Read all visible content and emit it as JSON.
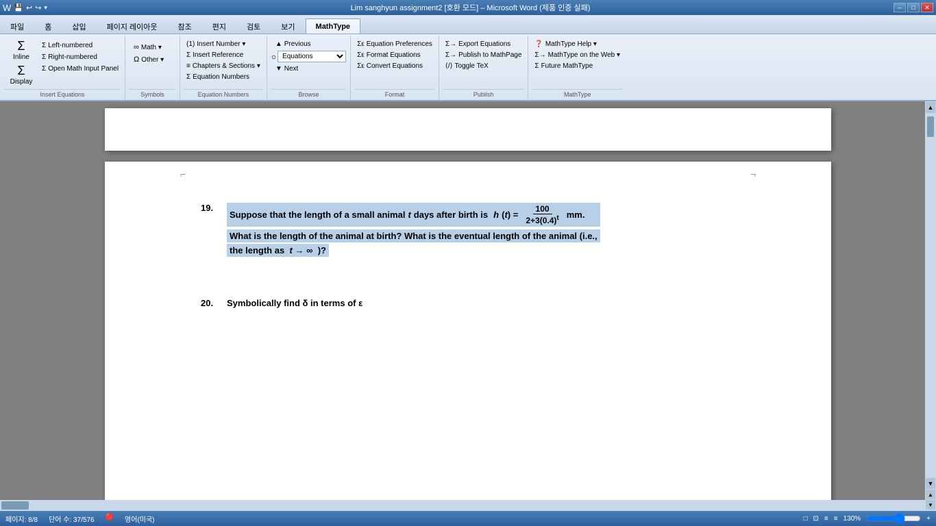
{
  "titlebar": {
    "title": "Lim sanghyun assignment2 [호환 모드] – Microsoft Word (제품 인증 실패)",
    "controls": [
      "–",
      "□",
      "✕"
    ]
  },
  "quickaccess": {
    "buttons": [
      "💾",
      "↩",
      "↪",
      "▾"
    ]
  },
  "tabs": [
    {
      "label": "파일",
      "active": false
    },
    {
      "label": "홈",
      "active": false
    },
    {
      "label": "삽입",
      "active": false
    },
    {
      "label": "페이지 레이아웃",
      "active": false
    },
    {
      "label": "참조",
      "active": false
    },
    {
      "label": "편지",
      "active": false
    },
    {
      "label": "검토",
      "active": false
    },
    {
      "label": "보기",
      "active": false
    },
    {
      "label": "MathType",
      "active": true
    }
  ],
  "ribbon": {
    "groups": [
      {
        "name": "Insert Equations",
        "items": [
          {
            "type": "large",
            "icon": "Σ",
            "label": "Inline"
          },
          {
            "type": "large",
            "icon": "Σ",
            "label": "Display"
          },
          {
            "type": "small",
            "icon": "Σ",
            "label": "Left-numbered"
          },
          {
            "type": "small",
            "icon": "Σ",
            "label": "Right-numbered"
          },
          {
            "type": "small",
            "icon": "Σ",
            "label": "Open Math Input Panel"
          }
        ]
      },
      {
        "name": "Symbols",
        "items": [
          {
            "icon": "∞",
            "label": "Math ▾"
          },
          {
            "icon": "Ω",
            "label": "Other ▾"
          }
        ]
      },
      {
        "name": "Equation Numbers",
        "items": [
          {
            "icon": "(1)",
            "label": "Insert Number ▾"
          },
          {
            "icon": "Σ",
            "label": "Insert Reference"
          },
          {
            "icon": "≡",
            "label": "Chapters & Sections ▾"
          },
          {
            "icon": "Σ",
            "label": "Equation Numbers"
          }
        ]
      },
      {
        "name": "Browse",
        "items": [
          {
            "label": "Previous"
          },
          {
            "label": "Equations"
          },
          {
            "label": "Next"
          }
        ],
        "dropdown": "Equations"
      },
      {
        "name": "Format",
        "items": [
          {
            "icon": "Σ",
            "label": "Equation Preferences"
          },
          {
            "icon": "Σ",
            "label": "Format Equations"
          },
          {
            "icon": "Σ",
            "label": "Convert Equations"
          }
        ]
      },
      {
        "name": "Publish",
        "items": [
          {
            "icon": "Σ",
            "label": "Export Equations"
          },
          {
            "icon": "Σ",
            "label": "Publish to MathPage"
          },
          {
            "icon": "Σ",
            "label": "Toggle TeX"
          }
        ]
      },
      {
        "name": "MathType",
        "items": [
          {
            "icon": "?",
            "label": "MathType Help ▾"
          },
          {
            "icon": "Σ",
            "label": "MathType on the Web ▾"
          },
          {
            "icon": "Σ",
            "label": "Future MathType"
          }
        ]
      }
    ]
  },
  "document": {
    "problem19": {
      "number": "19.",
      "text1": "Suppose that the length of a small animal",
      "var_t": "t",
      "text2": "days after birth is",
      "func": "h(t) =",
      "fraction_num": "100",
      "fraction_den": "2+3(0.4)",
      "exp": "t",
      "unit": "mm.",
      "text3": "What is the length of the animal at birth? What is the eventual length of the animal (i.e.,",
      "text4": "the length as",
      "arrow": "t → ∞",
      "text5": ")?"
    },
    "problem20": {
      "number": "20.",
      "text": "Symbolically find  δ in terms of  ε"
    }
  },
  "statusbar": {
    "page": "페이지: 8/8",
    "words": "단어 수: 37/576",
    "language": "영어(미국)",
    "zoom": "130%",
    "view_icons": [
      "□",
      "≡",
      "≡",
      "≡"
    ]
  }
}
